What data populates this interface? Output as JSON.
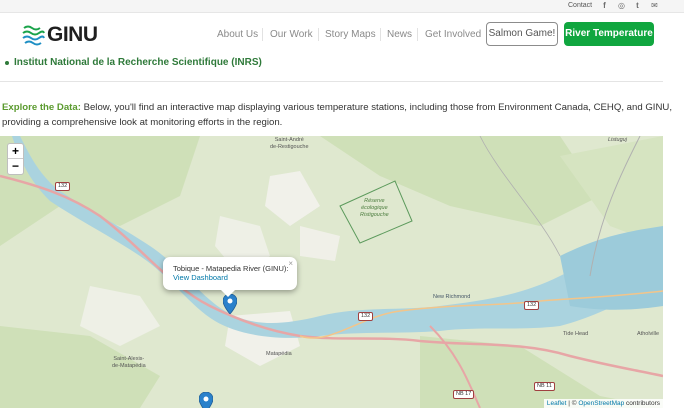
{
  "topbar": {
    "contact_label": "Contact",
    "social": [
      {
        "name": "facebook-icon",
        "glyph": "f"
      },
      {
        "name": "instagram-icon",
        "glyph": "◎"
      },
      {
        "name": "twitter-icon",
        "glyph": "t"
      },
      {
        "name": "email-icon",
        "glyph": "✉"
      }
    ]
  },
  "header": {
    "logo_text": "GINU",
    "nav": [
      "About Us",
      "Our Work",
      "Story Maps",
      "News",
      "Get Involved"
    ],
    "salmon_button": "Salmon Game!",
    "river_button": "River Temperature"
  },
  "content": {
    "bullet_link": "Institut National de la Recherche Scientifique (INRS)",
    "lead": "Explore the Data:",
    "paragraph": " Below, you'll find an interactive map displaying various temperature stations, including those from Environment Canada, CEHQ, and GINU, providing a comprehensive look at monitoring efforts in the region."
  },
  "map": {
    "zoom_in": "+",
    "zoom_out": "−",
    "labels": {
      "saint_andre": "Saint-André\nde-Restigouche",
      "listuguj": "Listuguj",
      "reserve": "Réserve\nécologique\nRistigouche",
      "new_richmond": "New Richmond",
      "tide_head": "Tide Head",
      "atholville": "Atholville",
      "matapedia": "Matapédia",
      "saint_alexis": "Saint-Alexis-\nde-Matapédia"
    },
    "shields": {
      "r132a": "132",
      "r132b": "132",
      "r132c": "132",
      "nb11": "NB 11",
      "nb17": "NB 17"
    },
    "popup": {
      "title": "Tobique - Matapedia River (GINU):",
      "link": "View Dashboard",
      "close": "×"
    },
    "attribution": {
      "leaflet": "Leaflet",
      "sep": " | © ",
      "osm": "OpenStreetMap",
      "suffix": " contributors"
    },
    "colors": {
      "forest": "#cfe0b8",
      "land": "#e8ecd8",
      "water": "#aad3df",
      "road": "#e0a0a0",
      "marker": "#2a81cb"
    }
  }
}
